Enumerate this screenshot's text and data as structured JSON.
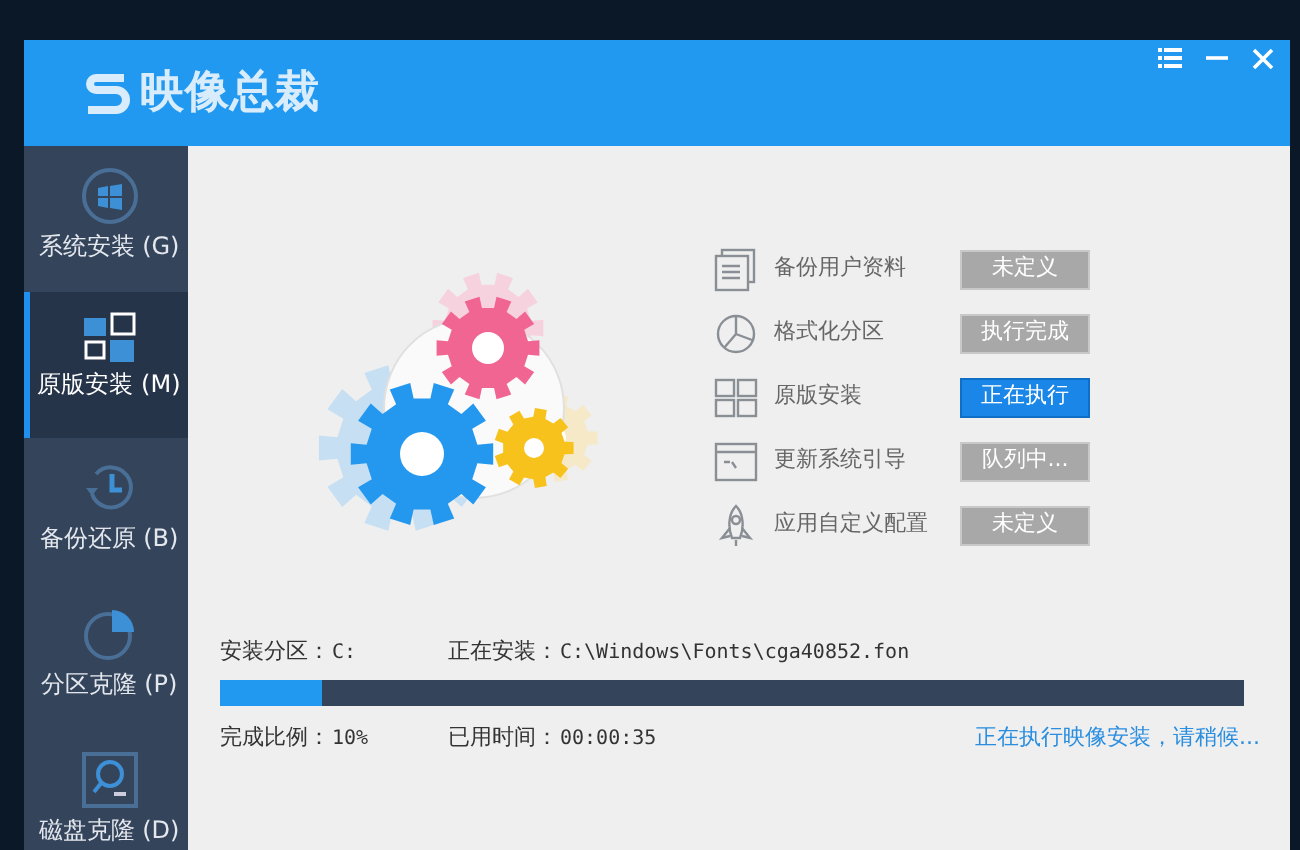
{
  "window": {
    "title": "映像总裁"
  },
  "sidebar": {
    "items": [
      {
        "label": "系统安装 (G)",
        "selected": false,
        "kind": "windows"
      },
      {
        "label": "原版安装 (M)",
        "selected": true,
        "kind": "tiles"
      },
      {
        "label": "备份还原 (B)",
        "selected": false,
        "kind": "clock"
      },
      {
        "label": "分区克隆 (P)",
        "selected": false,
        "kind": "pie"
      },
      {
        "label": "磁盘克隆 (D)",
        "selected": false,
        "kind": "disk"
      }
    ]
  },
  "steps": [
    {
      "label": "备份用户资料",
      "kind": "document",
      "status": "未定义",
      "selected": false
    },
    {
      "label": "格式化分区",
      "kind": "pie",
      "status": "执行完成",
      "selected": false
    },
    {
      "label": "原版安装",
      "kind": "tiles",
      "status": "正在执行",
      "selected": true
    },
    {
      "label": "更新系统引导",
      "kind": "console",
      "status": "队列中...",
      "selected": false
    },
    {
      "label": "应用自定义配置",
      "kind": "rocket",
      "status": "未定义",
      "selected": false
    }
  ],
  "progress": {
    "partition_label": "安装分区：",
    "partition": "C:",
    "installing_label": "正在安装：",
    "installing": "C:\\Windows\\Fonts\\cga40852.fon",
    "level": 0.1,
    "ratio_label": "完成比例：",
    "ratio": "10%",
    "elapsed_label": "已用时间：",
    "elapsed": "00:00:35",
    "message": "正在执行映像安装，请稍候..."
  }
}
